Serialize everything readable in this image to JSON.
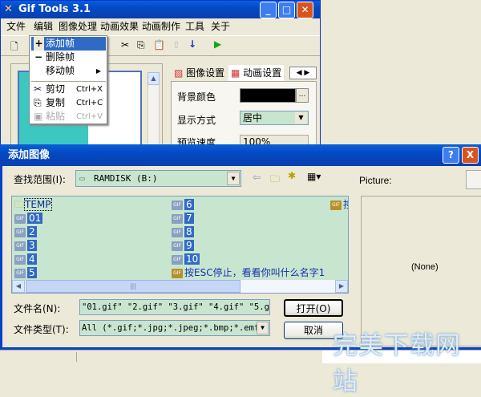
{
  "app": {
    "title": "Gif Tools 3.1",
    "menu": [
      "文件",
      "编辑",
      "图像处理",
      "动画效果",
      "动画制作",
      "工具",
      "关于"
    ]
  },
  "edit_menu": {
    "items": [
      {
        "label": "添加帧",
        "shortcut": ""
      },
      {
        "label": "删除帧",
        "shortcut": ""
      },
      {
        "label": "移动帧",
        "shortcut": ""
      },
      {
        "label": "剪切",
        "shortcut": "Ctrl+X"
      },
      {
        "label": "复制",
        "shortcut": "Ctrl+C"
      },
      {
        "label": "粘贴",
        "shortcut": "Ctrl+V"
      }
    ]
  },
  "tabs": [
    "图像设置",
    "动画设置"
  ],
  "settings": {
    "bg_label": "背景颜色",
    "bg_color": "#000000",
    "display_label": "显示方式",
    "display_value": "居中",
    "speed_label": "预览速度",
    "speed_value": "100%"
  },
  "dialog": {
    "title": "添加图像",
    "look_in_label": "查找范围(I):",
    "look_in_value": "RAMDISK (B:)",
    "picture_label": "Picture:",
    "preview_text": "(None)",
    "files": [
      "TEMP",
      "01",
      "2",
      "3",
      "4",
      "5",
      "6",
      "7",
      "8",
      "9",
      "10",
      "按ESC停止，看看你叫什么名字1",
      "按"
    ],
    "filename_label": "文件名(N):",
    "filename_value": "\"01.gif\" \"2.gif\" \"3.gif\" \"4.gif\" \"5.gif",
    "filetype_label": "文件类型(T):",
    "filetype_value": "All (*.gif;*.jpg;*.jpeg;*.bmp;*.emf;",
    "open": "打开(O)",
    "cancel": "取消",
    "help": "?",
    "close": "X"
  },
  "watermark": "完美下载网站"
}
